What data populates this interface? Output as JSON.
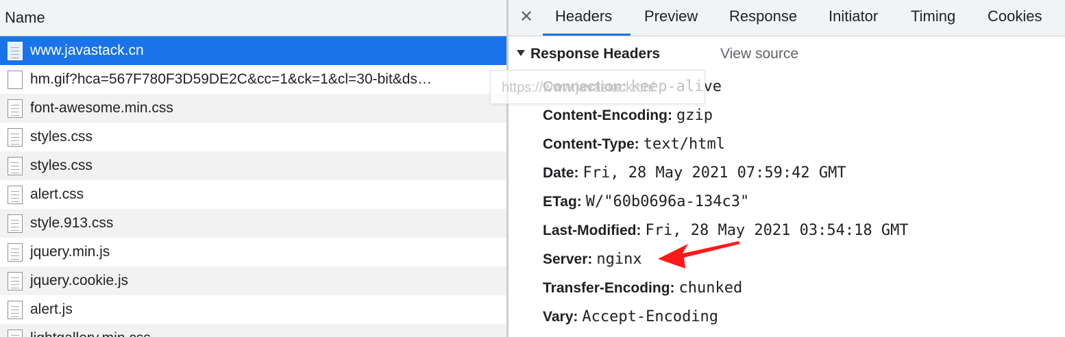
{
  "request_list": {
    "header": "Name",
    "rows": [
      {
        "name": "www.javastack.cn",
        "selected": true
      },
      {
        "name": "hm.gif?hca=567F780F3D59DE2C&cc=1&ck=1&cl=30-bit&ds…",
        "selected": false
      },
      {
        "name": "font-awesome.min.css",
        "selected": false
      },
      {
        "name": "styles.css",
        "selected": false
      },
      {
        "name": "styles.css",
        "selected": false
      },
      {
        "name": "alert.css",
        "selected": false
      },
      {
        "name": "style.913.css",
        "selected": false
      },
      {
        "name": "jquery.min.js",
        "selected": false
      },
      {
        "name": "jquery.cookie.js",
        "selected": false
      },
      {
        "name": "alert.js",
        "selected": false
      },
      {
        "name": "lightgallery.min.css",
        "selected": false
      }
    ]
  },
  "tooltip": {
    "text": "https://www.javastack.cn/"
  },
  "details": {
    "close_icon": "close-icon",
    "tabs": [
      "Headers",
      "Preview",
      "Response",
      "Initiator",
      "Timing",
      "Cookies"
    ],
    "active_tab": "Headers",
    "section_title": "Response Headers",
    "view_source": "View source",
    "headers": [
      {
        "key": "Connection:",
        "value": "keep-alive"
      },
      {
        "key": "Content-Encoding:",
        "value": "gzip"
      },
      {
        "key": "Content-Type:",
        "value": "text/html"
      },
      {
        "key": "Date:",
        "value": "Fri, 28 May 2021 07:59:42 GMT"
      },
      {
        "key": "ETag:",
        "value": "W/\"60b0696a-134c3\""
      },
      {
        "key": "Last-Modified:",
        "value": "Fri, 28 May 2021 03:54:18 GMT"
      },
      {
        "key": "Server:",
        "value": "nginx"
      },
      {
        "key": "Transfer-Encoding:",
        "value": "chunked"
      },
      {
        "key": "Vary:",
        "value": "Accept-Encoding"
      }
    ]
  },
  "colors": {
    "selection": "#1a73e8",
    "tab_indicator": "#1a73e8",
    "annotation_arrow": "#ff1a1a"
  }
}
